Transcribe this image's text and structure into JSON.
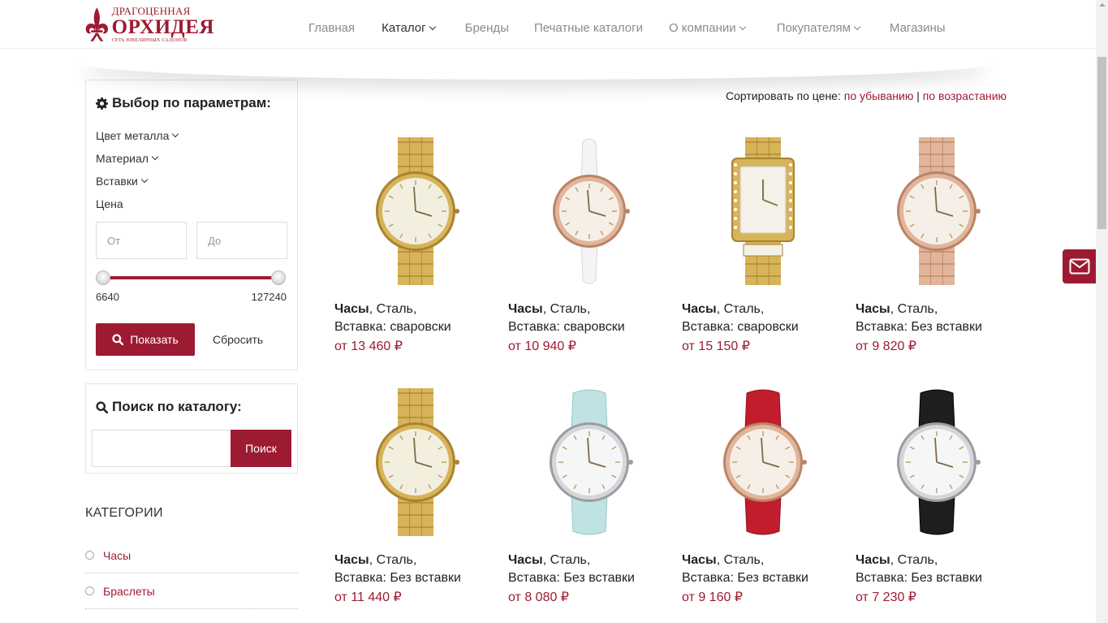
{
  "logo": {
    "line1": "ДРАГОЦЕННАЯ",
    "line2": "ОРХИДЕЯ",
    "line3": "СЕТЬ ЮВЕЛИРНЫХ САЛОНОВ",
    "icon": "fleur-de-lis-icon"
  },
  "nav": {
    "home": "Главная",
    "catalog": "Каталог",
    "brands": "Бренды",
    "print_catalogs": "Печатные каталоги",
    "about": "О компании",
    "buyers": "Покупателям",
    "stores": "Магазины",
    "active": "Каталог"
  },
  "filter": {
    "title": "Выбор по параметрам:",
    "metal_color": "Цвет металла",
    "material": "Материал",
    "inserts": "Вставки",
    "price": "Цена",
    "from_placeholder": "От",
    "to_placeholder": "До",
    "min": "6640",
    "max": "127240",
    "show_button": "Показать",
    "reset_button": "Сбросить"
  },
  "search": {
    "title": "Поиск по каталогу:",
    "button": "Поиск",
    "value": ""
  },
  "categories": {
    "title": "КАТЕГОРИИ",
    "items": [
      "Часы",
      "Браслеты"
    ]
  },
  "sort": {
    "label": "Сортировать по цене:",
    "desc": "по убыванию",
    "separator": "|",
    "asc": "по возрастанию"
  },
  "products": [
    {
      "name": "Часы",
      "material": ", Сталь,",
      "insert": "Вставка: сваровски",
      "price": "от 13 460 ₽",
      "case": "gold",
      "strap": "gold-bracelet"
    },
    {
      "name": "Часы",
      "material": ", Сталь,",
      "insert": "Вставка: сваровски",
      "price": "от 10 940 ₽",
      "case": "rose",
      "strap": "white-leather"
    },
    {
      "name": "Часы",
      "material": ", Сталь,",
      "insert": "Вставка: сваровски",
      "price": "от 15 150 ₽",
      "case": "gold-rect",
      "strap": "gold-bracelet"
    },
    {
      "name": "Часы",
      "material": ", Сталь,",
      "insert": "Вставка: Без вставки",
      "price": "от 9 820 ₽",
      "case": "rose",
      "strap": "rose-bracelet"
    },
    {
      "name": "Часы",
      "material": ", Сталь,",
      "insert": "Вставка: Без вставки",
      "price": "от 11 440 ₽",
      "case": "gold",
      "strap": "gold-bracelet"
    },
    {
      "name": "Часы",
      "material": ", Сталь,",
      "insert": "Вставка: Без вставки",
      "price": "от 8 080 ₽",
      "case": "silver",
      "strap": "mint-leather"
    },
    {
      "name": "Часы",
      "material": ", Сталь,",
      "insert": "Вставка: Без вставки",
      "price": "от 9 160 ₽",
      "case": "rose",
      "strap": "red-leather"
    },
    {
      "name": "Часы",
      "material": ", Сталь,",
      "insert": "Вставка: Без вставки",
      "price": "от 7 230 ₽",
      "case": "silver",
      "strap": "black-leather"
    }
  ],
  "colors": {
    "accent": "#9d1b32",
    "nav_text": "#8b8b8b"
  },
  "icons": {
    "filter": "gear-icon",
    "search": "search-icon",
    "mail": "envelope-icon"
  }
}
